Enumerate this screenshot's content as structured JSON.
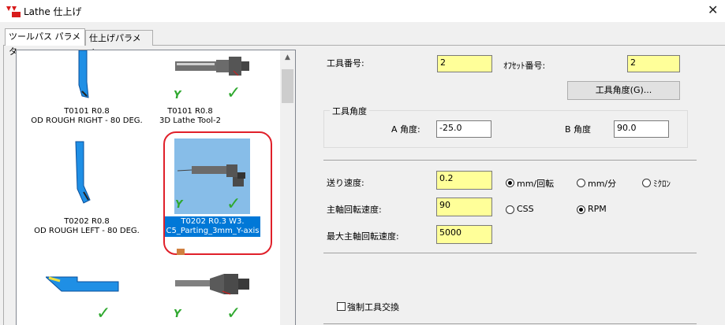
{
  "window": {
    "title": "Lathe 仕上げ",
    "close_glyph": "✕",
    "app_icon": "mastercam-logo-icon"
  },
  "tabs": [
    {
      "label": "ツールパス パラメタ",
      "active": true
    },
    {
      "label": "仕上げパラメタ",
      "active": false
    }
  ],
  "tool_list": {
    "items": [
      {
        "label_line1": "T0101 R0.8",
        "label_line2": "OD ROUGH RIGHT - 80 DEG.",
        "selected": false,
        "checked": false
      },
      {
        "label_line1": "T0101 R0.8",
        "label_line2": "3D Lathe Tool-2",
        "selected": false,
        "checked": true
      },
      {
        "label_line1": "T0202 R0.8",
        "label_line2": "OD ROUGH LEFT - 80 DEG.",
        "selected": false,
        "checked": false
      },
      {
        "label_line1": "T0202 R0.3 W3.",
        "label_line2": "C5_Parting_3mm_Y-axis",
        "selected": true,
        "checked": true
      },
      {
        "label_line1": "",
        "label_line2": "",
        "selected": false,
        "checked": true
      },
      {
        "label_line1": "",
        "label_line2": "",
        "selected": false,
        "checked": true
      }
    ]
  },
  "form": {
    "tool_number_label": "工具番号:",
    "tool_number_value": "2",
    "offset_number_label": "ｵﾌｾｯﾄ番号:",
    "offset_number_value": "2",
    "tool_angle_button": "工具角度(G)...",
    "tool_angle_group": "工具角度",
    "a_angle_label": "A 角度:",
    "a_angle_value": "-25.0",
    "b_angle_label": "B 角度",
    "b_angle_value": "90.0",
    "feed_rate_label": "送り速度:",
    "feed_rate_value": "0.2",
    "spindle_speed_label": "主軸回転速度:",
    "spindle_speed_value": "90",
    "max_spindle_label": "最大主軸回転速度:",
    "max_spindle_value": "5000",
    "feed_units": [
      {
        "label": "mm/回転",
        "selected": true
      },
      {
        "label": "mm/分",
        "selected": false
      },
      {
        "label": "ﾐｸﾛﾝ",
        "selected": false
      }
    ],
    "speed_modes": [
      {
        "label": "CSS",
        "selected": false
      },
      {
        "label": "RPM",
        "selected": true
      }
    ],
    "force_tool_change_label": "強制工具交換",
    "force_tool_change_checked": false
  },
  "colors": {
    "accent": "#0078d7",
    "input_yellow": "#ffff99",
    "check_green": "#2ea82e",
    "highlight_ring": "#e0202a",
    "tool_blue": "#1f8fe5"
  }
}
